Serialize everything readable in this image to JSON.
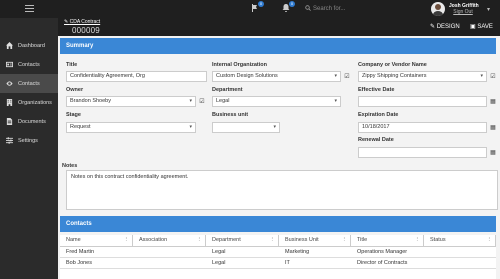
{
  "topbar": {
    "notif_flag_count": "0",
    "notif_bell_count": "0",
    "search_placeholder": "Search for...",
    "user_name": "Josh Griffith",
    "sign_out": "Sign Out"
  },
  "sidebar": {
    "items": [
      {
        "label": "Dashboard",
        "icon": "home-icon"
      },
      {
        "label": "Contacts",
        "icon": "id-card-icon"
      },
      {
        "label": "Contacts",
        "icon": "eye-icon"
      },
      {
        "label": "Organizations",
        "icon": "building-icon"
      },
      {
        "label": "Documents",
        "icon": "document-icon"
      },
      {
        "label": "Settings",
        "icon": "sliders-icon"
      }
    ]
  },
  "header": {
    "breadcrumb": "CDA Contract",
    "record_id": "000009",
    "design_label": "DESIGN",
    "save_label": "SAVE"
  },
  "summary": {
    "title": "Summary",
    "title_label": "Title",
    "title_value": "Confidentiality Agreement, Org",
    "internal_org_label": "Internal Organization",
    "internal_org_value": "Custom Design Solutions",
    "company_label": "Company or Vendor Name",
    "company_value": "Zippy Shipping Containers",
    "owner_label": "Owner",
    "owner_value": "Brandon Shoeby",
    "department_label": "Department",
    "department_value": "Legal",
    "effective_date_label": "Effective Date",
    "effective_date_value": "",
    "stage_label": "Stage",
    "stage_value": "Request",
    "business_unit_label": "Business unit",
    "business_unit_value": "",
    "expiration_date_label": "Expiration Date",
    "expiration_date_value": "10/18/2017",
    "renewal_date_label": "Renewal Date",
    "renewal_date_value": "",
    "notes_label": "Notes",
    "notes_value": "Notes on this contract confidentiality agreement."
  },
  "contacts": {
    "title": "Contacts",
    "columns": [
      "Name",
      "Association",
      "Department",
      "Business Unit",
      "Title",
      "Status"
    ],
    "rows": [
      [
        "Fred Martin",
        "",
        "Legal",
        "Marketing",
        "Operations Manager",
        ""
      ],
      [
        "Bob Jones",
        "",
        "Legal",
        "IT",
        "Director of Contracts",
        ""
      ]
    ]
  }
}
